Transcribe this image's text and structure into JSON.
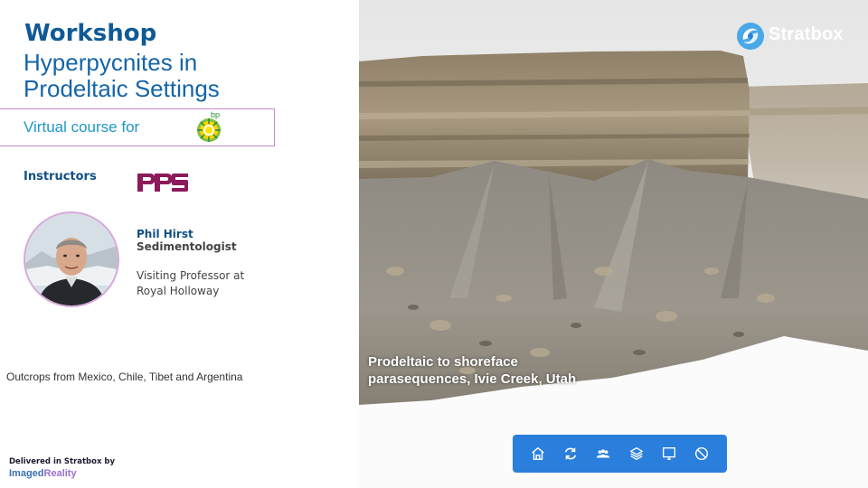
{
  "header": {
    "title_bold": "Workshop",
    "title_line1": "Hyperpycnites in",
    "title_line2": "Prodeltaic Settings"
  },
  "course": {
    "label": "Virtual course for",
    "sponsor_logo": "bp-logo",
    "sponsor_text": "bp"
  },
  "instructors": {
    "heading": "Instructors",
    "company_logo": "rps-logo",
    "company_text": "rps",
    "name": "Phil  Hirst",
    "role": "Sedimentologist",
    "affiliation_line1": "Visiting Professor at",
    "affiliation_line2": "Royal Holloway"
  },
  "outcrops_note": "Outcrops from Mexico, Chile, Tibet and Argentina",
  "footer": {
    "delivered": "Delivered  in Stratbox by",
    "imaged": "Imaged",
    "reality": "Reality"
  },
  "viewer": {
    "brand": "Stratbox",
    "caption_line1": "Prodeltaic to shoreface",
    "caption_line2": "parasequences, Ivie Creek, Utah",
    "toolbar": [
      {
        "icon": "home-icon",
        "label": "Home"
      },
      {
        "icon": "refresh-icon",
        "label": "Reset"
      },
      {
        "icon": "users-icon",
        "label": "Users"
      },
      {
        "icon": "layers-icon",
        "label": "Layers"
      },
      {
        "icon": "monitor-icon",
        "label": "Display"
      },
      {
        "icon": "block-icon",
        "label": "Disable"
      }
    ]
  },
  "colors": {
    "title": "#0f5a96",
    "accent_border": "#c888c8",
    "toolbar": "#2b7fdc",
    "rps": "#8b1b5a",
    "bp_green": "#2f8b3a"
  }
}
